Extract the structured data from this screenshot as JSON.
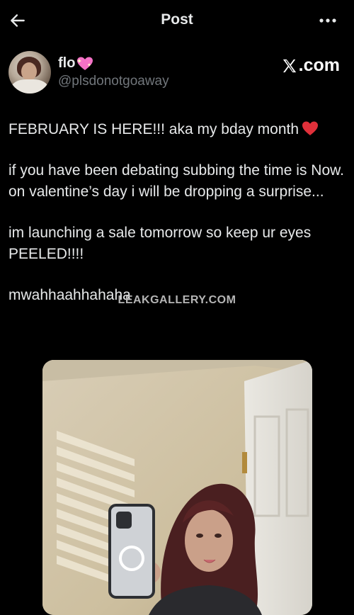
{
  "header": {
    "title": "Post",
    "back_icon": "arrow-left-icon",
    "more_icon": "more-horizontal-icon"
  },
  "author": {
    "name": "flo",
    "name_emoji": "sparkling-heart-icon",
    "handle": "@plsdonotgoaway",
    "source_label": ".com",
    "source_icon": "x-logo-icon"
  },
  "post": {
    "line1": "FEBRUARY IS HERE!!! aka my bday month",
    "line1_emoji": "red-heart-icon",
    "paragraph2": "if you have been debating subbing the time is Now. on valentine’s day i will be dropping a surprise...",
    "paragraph3": "im launching a sale tomorrow so keep ur eyes PEELED!!!!",
    "paragraph4": "mwahhaahhahaha"
  },
  "watermark": "LEAKGALLERY.COM",
  "colors": {
    "background": "#000000",
    "text": "#e7e9ea",
    "secondary_text": "#71767b",
    "heart": "#f91880"
  }
}
